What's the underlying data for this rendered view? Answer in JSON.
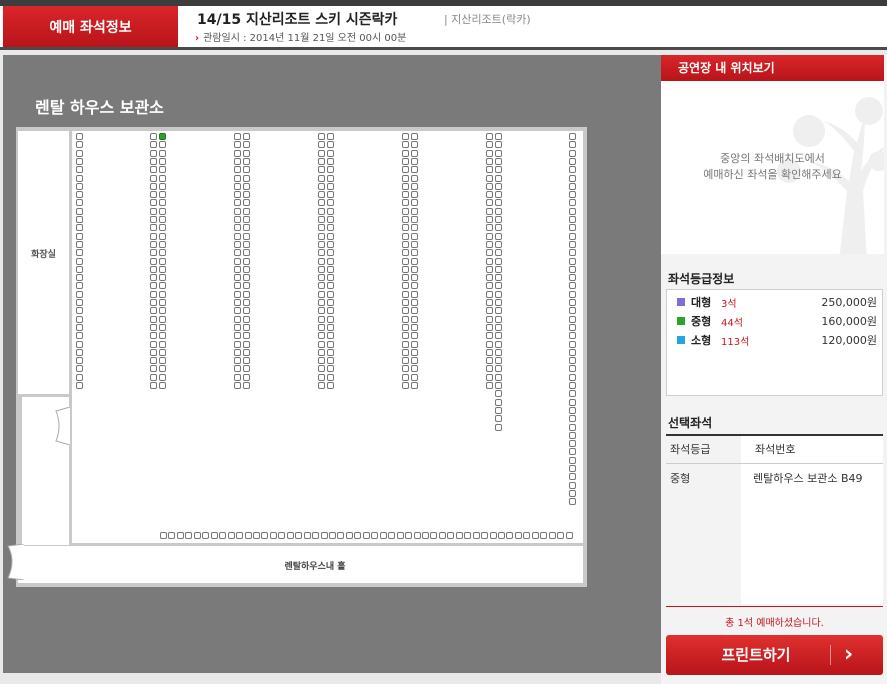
{
  "header": {
    "tag": "예매 좌석정보",
    "title": "14/15 지산리조트 스키 시즌락카",
    "venue": "| 지산리조트(락카)",
    "date": "관람일시 : 2014년 11월 21일 오전 00시 00분"
  },
  "map": {
    "title": "렌탈 하우스 보관소",
    "restroom": "화장실",
    "hall": "렌탈하우스내 홀"
  },
  "location": {
    "header": "공연장 내 위치보기",
    "message_line1": "중앙의 좌석배치도에서",
    "message_line2": "예매하신 좌석을 확인해주세요"
  },
  "grades": {
    "title": "좌석등급정보",
    "items": [
      {
        "name": "대형",
        "count": "3석",
        "price": "250,000원",
        "color": "#7b6fd6"
      },
      {
        "name": "중형",
        "count": "44석",
        "price": "160,000원",
        "color": "#2aa52a"
      },
      {
        "name": "소형",
        "count": "113석",
        "price": "120,000원",
        "color": "#23a6e0"
      }
    ]
  },
  "selected": {
    "title": "선택좌석",
    "col_grade": "좌석등급",
    "col_seat": "좌석번호",
    "rows": [
      {
        "grade": "중형",
        "seat": "렌탈하우스 보관소 B49"
      }
    ]
  },
  "summary": "총 1석 예매하셨습니다.",
  "print_label": "프린트하기",
  "colors": {
    "accent": "#c4161c",
    "selected_seat": "#2aa52a"
  }
}
